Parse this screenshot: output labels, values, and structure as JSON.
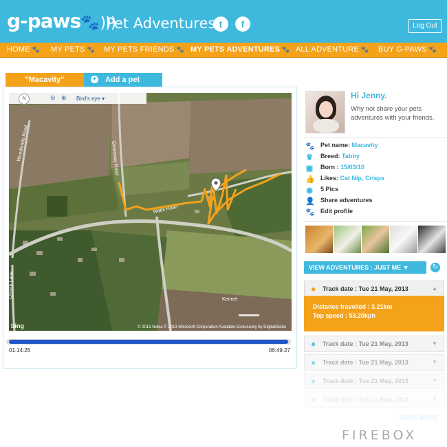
{
  "brand": {
    "logo_text": "g-paws",
    "paw_icon": "paw-icon",
    "page_title": "Pet Adventures.",
    "twitter_icon": "t",
    "facebook_icon": "f",
    "logout_label": "Log Out",
    "colors": {
      "primary": "#3fb8de",
      "accent": "#f4a21a",
      "progress": "#1f56c8"
    }
  },
  "nav": {
    "items": [
      {
        "label": "HOME"
      },
      {
        "label": "MY PETS"
      },
      {
        "label": "MY PETS FRIENDS"
      },
      {
        "label": "MY PETS ADVENTURES"
      },
      {
        "label": "ALL ADVENTURE"
      },
      {
        "label": "BUY G-PAWS"
      }
    ]
  },
  "tabs": {
    "pet_label": "\"Macavity\"",
    "add_label": "Add a pet"
  },
  "map": {
    "compass_label": "N",
    "view_mode": "Bird's eye",
    "road_labels": [
      "Woodlands Road",
      "Greenway Road",
      "Watts Road",
      "Church Lane",
      "Kennet"
    ],
    "copyright": "© 2013 Nokia   © 2013 Microsoft Corporation   Available Exclusively by DigitalGlobe",
    "logo": "bing"
  },
  "playback": {
    "start_time": "01:14:26",
    "end_time": "06:49:27",
    "progress": 1.0
  },
  "profile": {
    "greeting": "Hi Jenny.",
    "subtext": "Why not share your pets adventures with your friends.",
    "pet_name_label": "Pet name:",
    "pet_name": "Macavity",
    "breed_label": "Breed:",
    "breed": "Tabby",
    "born_label": "Born :",
    "born": "15/03/10",
    "likes_label": "Likes:",
    "likes": "Cat Nip, Crisps",
    "pics": "5 Pics",
    "share": "Share adventures",
    "edit": "Edit profile"
  },
  "adventures": {
    "view_button": "VIEW ADVENTURES : JUST ME ▼",
    "active_track": {
      "date": "Track date : Tue 21 May, 2013",
      "distance": "Distance travelled : 3.21km",
      "speed": "Top speed : 53.20kph"
    },
    "other_tracks": [
      "Track date : Tue 21 May, 2013",
      "Track date : Tue 21 May, 2013",
      "Track date : Tue 21 May, 2013",
      "Track date : Tue 21 May, 2013"
    ],
    "show_more": "SHOW MORE"
  },
  "footer": {
    "brand": "FIREBOX"
  }
}
